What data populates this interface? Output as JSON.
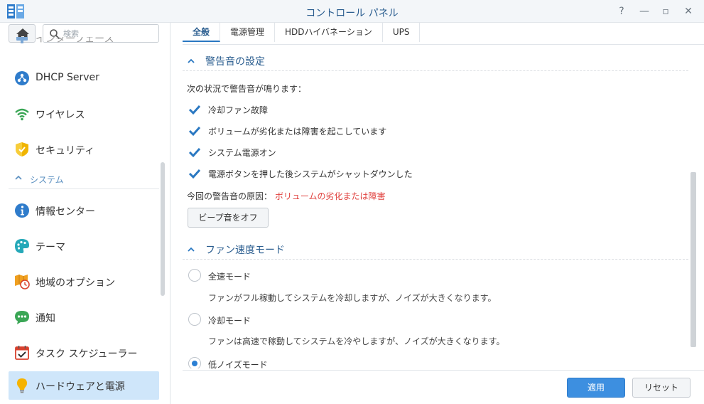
{
  "window": {
    "title": "コントロール パネル",
    "help_symbol": "?",
    "minimize_symbol": "—",
    "maximize_symbol": "▫",
    "close_symbol": "✕"
  },
  "sidebar": {
    "search_placeholder": "検索",
    "partial_item": "インターフェース",
    "items": [
      {
        "label": "DHCP Server",
        "icon": "dhcp-icon"
      },
      {
        "label": "ワイヤレス",
        "icon": "wifi-icon"
      },
      {
        "label": "セキュリティ",
        "icon": "shield-icon"
      }
    ],
    "section": "システム",
    "system_items": [
      {
        "label": "情報センター",
        "icon": "info-icon"
      },
      {
        "label": "テーマ",
        "icon": "palette-icon"
      },
      {
        "label": "地域のオプション",
        "icon": "map-clock-icon"
      },
      {
        "label": "通知",
        "icon": "chat-bubble-icon"
      },
      {
        "label": "タスク スケジューラー",
        "icon": "calendar-check-icon"
      },
      {
        "label": "ハードウェアと電源",
        "icon": "lightbulb-icon",
        "active": true
      }
    ]
  },
  "tabs": [
    {
      "label": "全般",
      "active": true
    },
    {
      "label": "電源管理",
      "active": false
    },
    {
      "label": "HDDハイバネーション",
      "active": false
    },
    {
      "label": "UPS",
      "active": false
    }
  ],
  "beep": {
    "title": "警告音の設定",
    "intro": "次の状況で警告音が鳴ります：",
    "checkboxes": [
      {
        "label": "冷却ファン故障",
        "checked": true
      },
      {
        "label": "ボリュームが劣化または障害を起こしています",
        "checked": true
      },
      {
        "label": "システム電源オン",
        "checked": true
      },
      {
        "label": "電源ボタンを押した後システムがシャットダウンした",
        "checked": true
      }
    ],
    "cause_label": "今回の警告音の原因：",
    "cause_value": "ボリュームの劣化または障害",
    "beep_off_button": "ビープ音をオフ"
  },
  "fan": {
    "title": "ファン速度モード",
    "options": [
      {
        "label": "全速モード",
        "desc": "ファンがフル稼動してシステムを冷却しますが、ノイズが大きくなります。",
        "checked": false
      },
      {
        "label": "冷却モード",
        "desc": "ファンは高速で稼動してシステムを冷やしますが、ノイズが大きくなります。",
        "checked": false
      },
      {
        "label": "低ノイズモード",
        "checked": true
      }
    ]
  },
  "footer": {
    "apply": "適用",
    "reset": "リセット"
  },
  "colors": {
    "accent": "#2a78c2",
    "apply_button": "#3d8fe0",
    "warning_text": "#e0413e",
    "active_nav": "#cfe6fa"
  }
}
